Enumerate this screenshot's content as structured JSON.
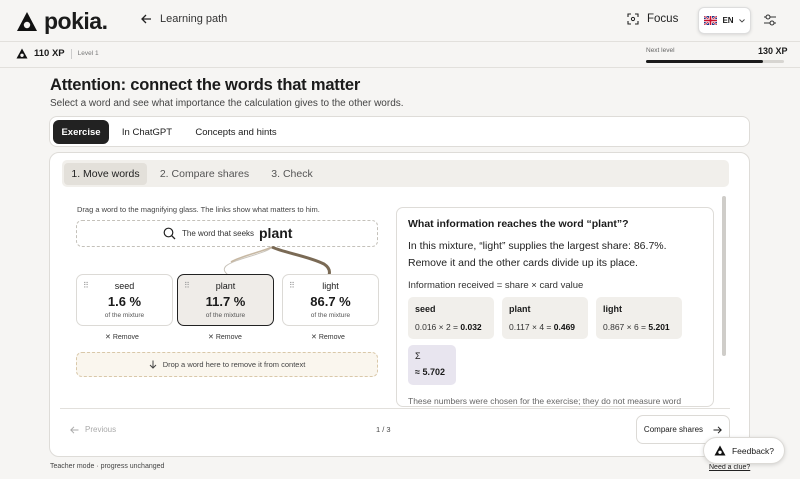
{
  "header": {
    "logo_text": "pokia.",
    "back_label": "Learning path",
    "focus_label": "Focus",
    "language": "EN"
  },
  "xp": {
    "value": "110 XP",
    "level": "Level 1",
    "next_label": "Next level",
    "next_value": "130 XP",
    "progress_fraction": 0.85
  },
  "lesson": {
    "title": "Attention: connect the words that matter",
    "subtitle": "Select a word and see what importance the calculation gives to the other words.",
    "tabs": [
      {
        "label": "Exercise",
        "active": true
      },
      {
        "label": "In ChatGPT",
        "active": false
      },
      {
        "label": "Concepts and hints",
        "active": false
      }
    ]
  },
  "steps": [
    {
      "label": "1. Move words",
      "active": true
    },
    {
      "label": "2. Compare shares",
      "active": false
    },
    {
      "label": "3. Check",
      "active": false
    }
  ],
  "exercise": {
    "instruction": "Drag a word to the magnifying glass. The links show what matters to him.",
    "search_label": "The word that seeks",
    "search_word": "plant",
    "cards": [
      {
        "word": "seed",
        "pct": "1.6 %",
        "sub": "of the mixture",
        "remove": "Remove"
      },
      {
        "word": "plant",
        "pct": "11.7 %",
        "sub": "of the mixture",
        "remove": "Remove"
      },
      {
        "word": "light",
        "pct": "86.7 %",
        "sub": "of the mixture",
        "remove": "Remove"
      }
    ],
    "dropzone": "Drop a word here to remove it from context"
  },
  "panel": {
    "title": "What information reaches the word “plant”?",
    "text": "In this mixture, “light” supplies the largest share: 86.7%. Remove it and the other cards divide up its place.",
    "formula": "Information received = share × card value",
    "items": [
      {
        "name": "seed",
        "calc": "0.016 × 2 = ",
        "result": "0.032"
      },
      {
        "name": "plant",
        "calc": "0.117 × 4 = ",
        "result": "0.469"
      },
      {
        "name": "light",
        "calc": "0.867 × 6 = ",
        "result": "5.201"
      }
    ],
    "sum_symbol": "Σ",
    "sum_value": "≈ 5.702",
    "note": "These numbers were chosen for the exercise; they do not measure word"
  },
  "nav": {
    "previous": "Previous",
    "page": "1 / 3",
    "next": "Compare shares"
  },
  "footer": {
    "left": "Teacher mode · progress unchanged",
    "clue": "Need a clue?",
    "feedback": "Feedback?"
  }
}
